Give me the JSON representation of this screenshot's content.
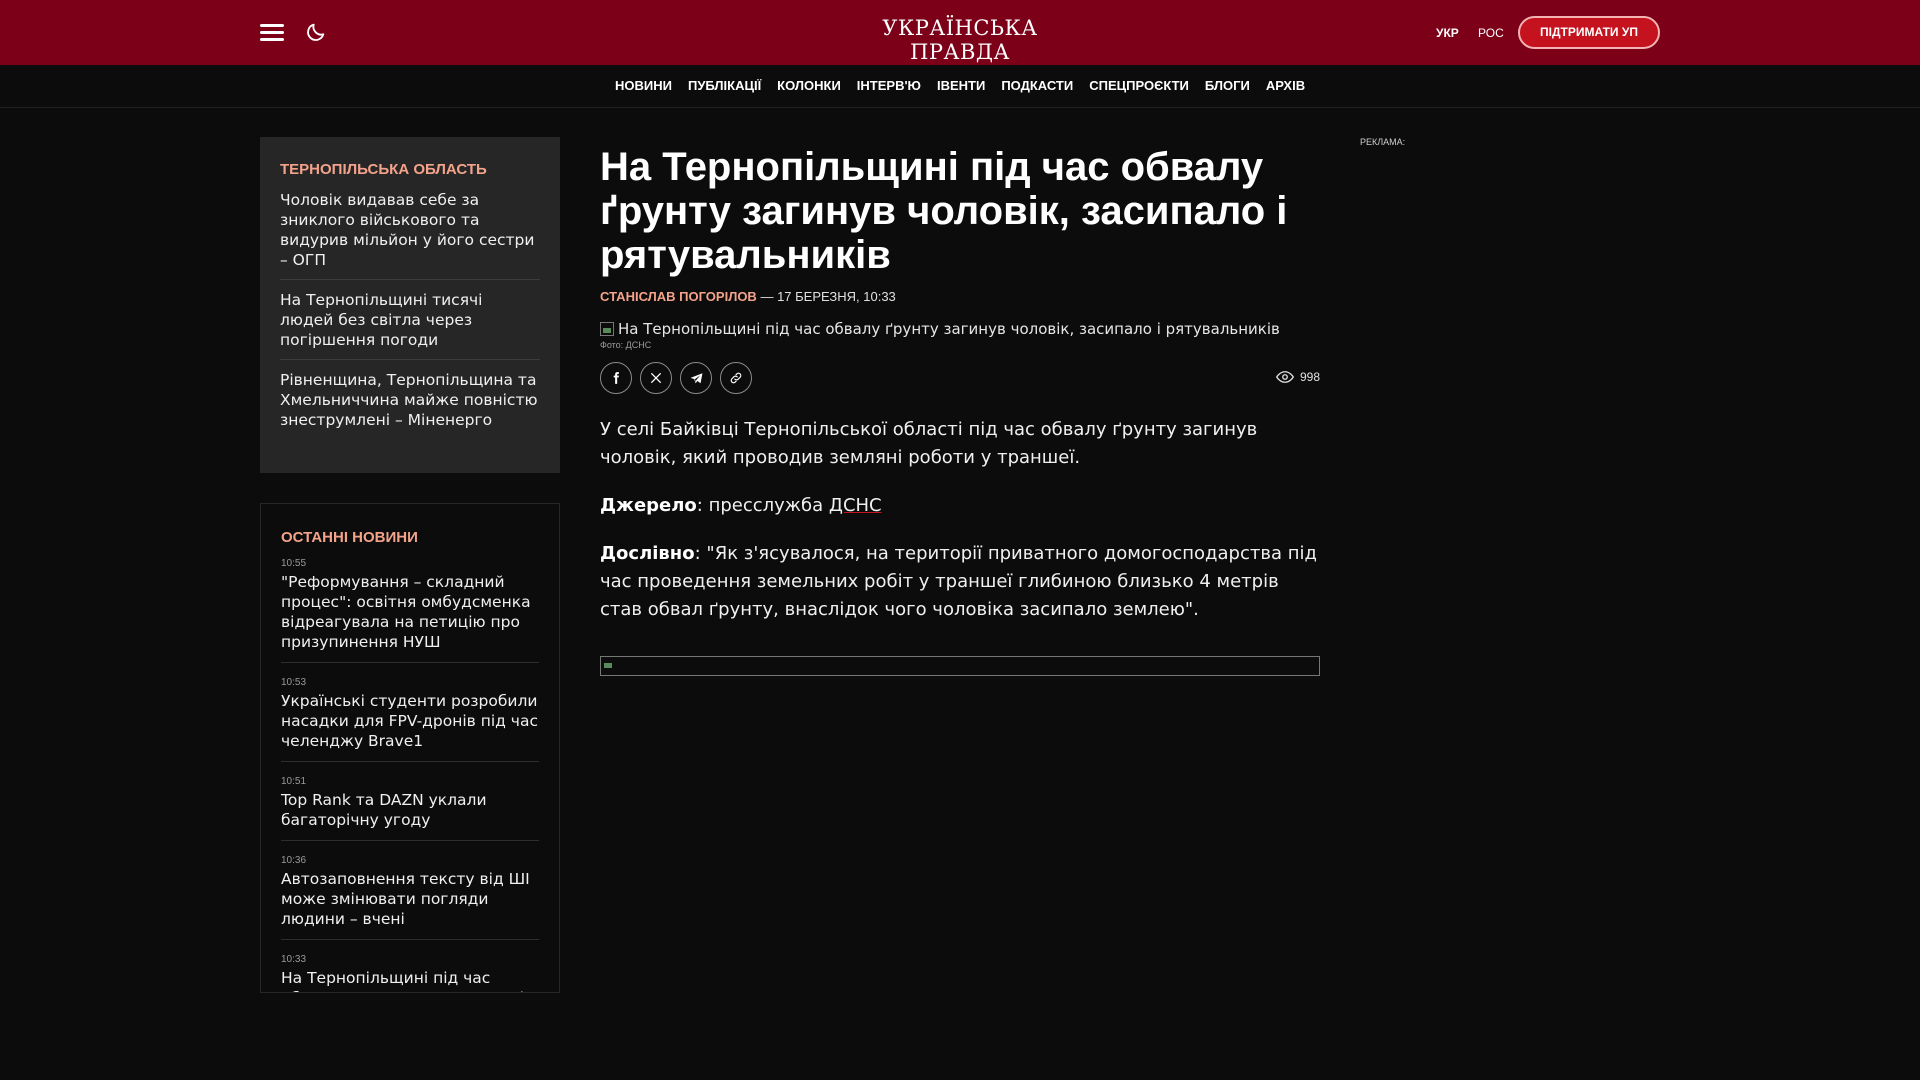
{
  "header": {
    "logo": "УКРАЇНСЬКА ПРАВДА",
    "lang_ukr": "УКР",
    "lang_ros": "РОС",
    "support_label": "ПІДТРИМАТИ УП",
    "brand_color": "#7c0018",
    "accent_color": "#c4121e"
  },
  "nav": {
    "items": [
      "НОВИНИ",
      "ПУБЛІКАЦІЇ",
      "КОЛОНКИ",
      "ІНТЕРВ'Ю",
      "ІВЕНТИ",
      "ПОДКАСТИ",
      "СПЕЦПРОЄКТИ",
      "БЛОГИ",
      "АРХІВ"
    ]
  },
  "region": {
    "title": "ТЕРНОПІЛЬСЬКА ОБЛАСТЬ",
    "items": [
      "Чоловік видавав себе за зниклого військового та видурив мільйон у його сестри – ОГП",
      "На Тернопільщині тисячі людей без світла через погіршення погоди",
      "Рівненщина, Тернопільщина та Хмельниччина майже повністю знеструмлені – Міненерго"
    ]
  },
  "latest": {
    "title": "ОСТАННІ НОВИНИ",
    "items": [
      {
        "time": "10:55",
        "title": "\"Реформування – складний процес\": освітня омбудсменка відреагувала на петицію про призупинення НУШ"
      },
      {
        "time": "10:53",
        "title": "Українські студенти розробили насадки для FPV-дронів під час челенджу Brave1"
      },
      {
        "time": "10:51",
        "title": "Top Rank та DAZN уклали багаторічну угоду"
      },
      {
        "time": "10:36",
        "title": "Автозаповнення тексту від ШІ може змінювати погляди людини – вчені"
      },
      {
        "time": "10:33",
        "title": "На Тернопільщині під час обвалу ґрунту загинув чоловік"
      }
    ]
  },
  "article": {
    "headline": "На Тернопільщині під час обвалу ґрунту загинув чоловік, засипало і рятувальників",
    "author": "СТАНІСЛАВ ПОГОРІЛОВ",
    "date": "— 17 БЕРЕЗНЯ, 10:33",
    "image_alt": "На Тернопільщині під час обвалу ґрунту загинув чоловік, засипало і рятувальників",
    "photo_credit": "Фото: ДСНС",
    "views": "998",
    "lead": "У селі Байківці Тернопільської області під час обвалу ґрунту загинув чоловік, який проводив земляні роботи у траншеї.",
    "source_label": "Джерело",
    "source_text": ": пресслужба ",
    "source_link": "ДСНС",
    "quote_label": "Дослівно",
    "quote_text": ": \"Як з'ясувалося, на території приватного домогосподарства під час проведення земельних робіт у траншеї глибиною близько 4 метрів став обвал ґрунту, внаслідок чого чоловіка засипало землею\"."
  },
  "ad": {
    "label": "РЕКЛАМА:"
  }
}
